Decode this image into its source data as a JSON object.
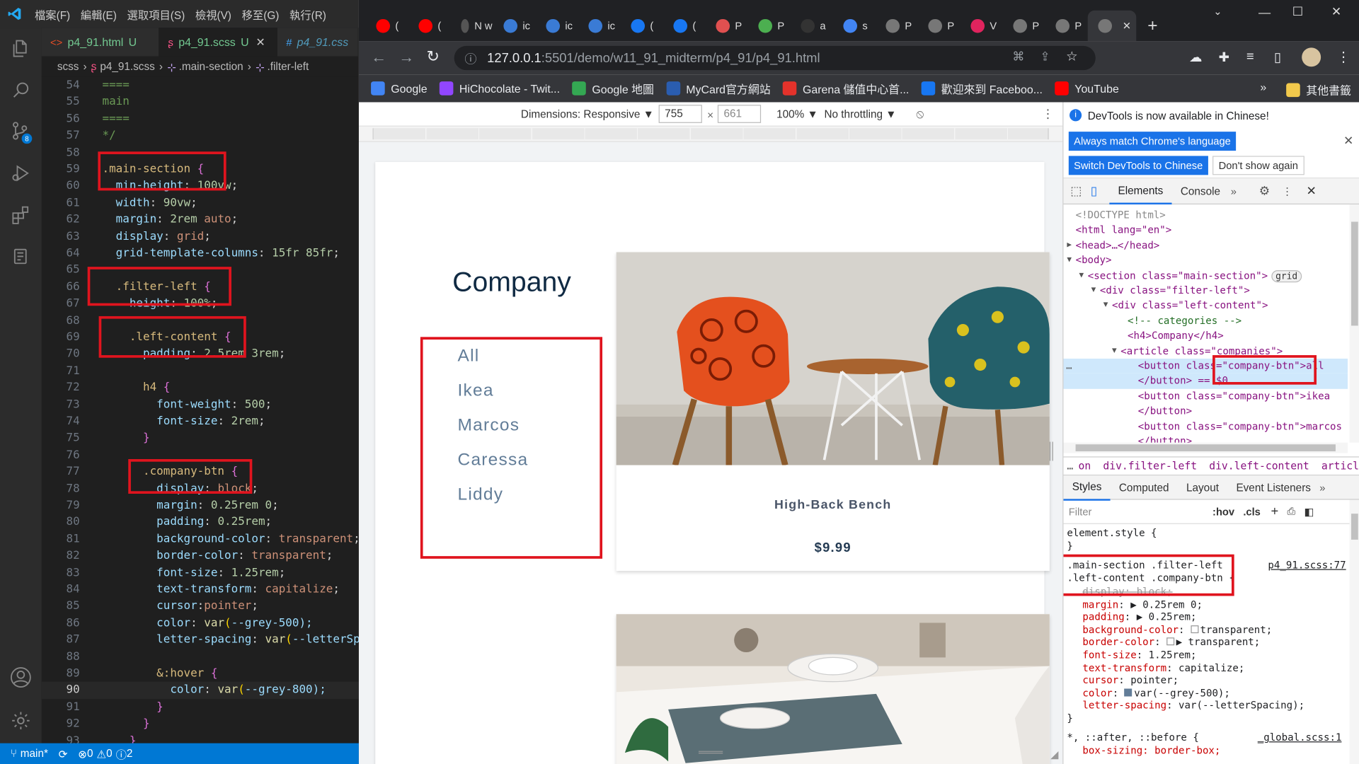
{
  "vscode": {
    "menu": [
      "檔案(F)",
      "編輯(E)",
      "選取項目(S)",
      "檢視(V)",
      "移至(G)",
      "執行(R)"
    ],
    "tabs": [
      {
        "label": "p4_91.html",
        "status": "U",
        "icon": "<>"
      },
      {
        "label": "p4_91.scss",
        "status": "U",
        "icon": "ʂ",
        "close": "✕"
      },
      {
        "label": "p4_91.css",
        "icon": "#"
      }
    ],
    "breadcrumb": [
      "scss",
      "p4_91.scss",
      ".main-section",
      ".filter-left"
    ],
    "status": {
      "branch": "main*",
      "errors": "0",
      "warnings": "0",
      "info": "2"
    },
    "lines": [
      {
        "n": "54",
        "t": "===="
      },
      {
        "n": "55",
        "t": "main"
      },
      {
        "n": "56",
        "t": "===="
      },
      {
        "n": "57",
        "t": "*/"
      },
      {
        "n": "58",
        "t": ""
      },
      {
        "n": "59",
        "t": ".main-section {"
      },
      {
        "n": "60",
        "t": "  min-height: 100vw;"
      },
      {
        "n": "61",
        "t": "  width: 90vw;"
      },
      {
        "n": "62",
        "t": "  margin: 2rem auto;"
      },
      {
        "n": "63",
        "t": "  display: grid;"
      },
      {
        "n": "64",
        "t": "  grid-template-columns: 15fr 85fr;"
      },
      {
        "n": "65",
        "t": ""
      },
      {
        "n": "66",
        "t": "  .filter-left {"
      },
      {
        "n": "67",
        "t": "    height: 100%;"
      },
      {
        "n": "68",
        "t": ""
      },
      {
        "n": "69",
        "t": "    .left-content {"
      },
      {
        "n": "70",
        "t": "      padding: 2.5rem 3rem;"
      },
      {
        "n": "71",
        "t": ""
      },
      {
        "n": "72",
        "t": "      h4 {"
      },
      {
        "n": "73",
        "t": "        font-weight: 500;"
      },
      {
        "n": "74",
        "t": "        font-size: 2rem;"
      },
      {
        "n": "75",
        "t": "      }"
      },
      {
        "n": "76",
        "t": ""
      },
      {
        "n": "77",
        "t": "      .company-btn {"
      },
      {
        "n": "78",
        "t": "        display: block;"
      },
      {
        "n": "79",
        "t": "        margin: 0.25rem 0;"
      },
      {
        "n": "80",
        "t": "        padding: 0.25rem;"
      },
      {
        "n": "81",
        "t": "        background-color: transparent;"
      },
      {
        "n": "82",
        "t": "        border-color: transparent;"
      },
      {
        "n": "83",
        "t": "        font-size: 1.25rem;"
      },
      {
        "n": "84",
        "t": "        text-transform: capitalize;"
      },
      {
        "n": "85",
        "t": "        cursor:pointer;"
      },
      {
        "n": "86",
        "t": "        color: var(--grey-500);"
      },
      {
        "n": "87",
        "t": "        letter-spacing: var(--letterSp"
      },
      {
        "n": "88",
        "t": ""
      },
      {
        "n": "89",
        "t": "        &:hover {"
      },
      {
        "n": "90",
        "t": "          color: var(--grey-800);"
      },
      {
        "n": "91",
        "t": "        }"
      },
      {
        "n": "92",
        "t": "      }"
      },
      {
        "n": "93",
        "t": "    }"
      }
    ]
  },
  "chrome": {
    "tabs": [
      {
        "label": "(",
        "color": "#ff0000"
      },
      {
        "label": "(",
        "color": "#ff0000"
      },
      {
        "label": "N w",
        "color": "#555"
      },
      {
        "label": "ic",
        "color": "#3a7bd5"
      },
      {
        "label": "ic",
        "color": "#3a7bd5"
      },
      {
        "label": "ic",
        "color": "#3a7bd5"
      },
      {
        "label": "(",
        "color": "#1877f2"
      },
      {
        "label": "(",
        "color": "#1877f2"
      },
      {
        "label": "P",
        "color": "#e05050"
      },
      {
        "label": "P",
        "color": "#4caf50"
      },
      {
        "label": "a",
        "color": "#333"
      },
      {
        "label": "s",
        "color": "#4285f4"
      },
      {
        "label": "P",
        "color": "#777"
      },
      {
        "label": "P",
        "color": "#777"
      },
      {
        "label": "V",
        "color": "#e0245e"
      },
      {
        "label": "P",
        "color": "#777"
      },
      {
        "label": "P",
        "color": "#777"
      },
      {
        "label": "",
        "color": "#777"
      }
    ],
    "new_tab": "+",
    "url_host": "127.0.0.1",
    "url_path": ":5501/demo/w11_91_midterm/p4_91/p4_91.html",
    "bookmarks": [
      {
        "label": "Google",
        "color": "#4285f4"
      },
      {
        "label": "HiChocolate - Twit...",
        "color": "#9146ff"
      },
      {
        "label": "Google 地圖",
        "color": "#34a853"
      },
      {
        "label": "MyCard官方網站",
        "color": "#2a5db0"
      },
      {
        "label": "Garena 儲值中心首...",
        "color": "#e4322b"
      },
      {
        "label": "歡迎來到 Faceboo...",
        "color": "#1877f2"
      },
      {
        "label": "YouTube",
        "color": "#ff0000"
      }
    ],
    "bookmarks_more": "»",
    "other_bookmarks": "其他書籤"
  },
  "devmode": {
    "dimensions_label": "Dimensions: Responsive ▼",
    "width": "755",
    "height": "661",
    "zoom": "100% ▼",
    "throttle": "No throttling ▼"
  },
  "page": {
    "title": "Company",
    "companies": [
      "All",
      "Ikea",
      "Marcos",
      "Caressa",
      "Liddy"
    ],
    "products": [
      {
        "name": "High-Back Bench",
        "price": "$9.99"
      }
    ]
  },
  "devtools": {
    "notice": "DevTools is now available in Chinese!",
    "btn_match": "Always match Chrome's language",
    "btn_switch": "Switch DevTools to Chinese",
    "btn_dont": "Don't show again",
    "tabs": [
      "Elements",
      "Console"
    ],
    "crumbs": [
      "on",
      "div.filter-left",
      "div.left-content",
      "article.compan"
    ],
    "style_tabs": [
      "Styles",
      "Computed",
      "Layout",
      "Event Listeners"
    ],
    "filter_placeholder": "Filter",
    "hov": ":hov",
    "cls": ".cls",
    "dom": [
      "<!DOCTYPE html>",
      "<html lang=\"en\">",
      "<head>…</head>",
      "<body>",
      "<section class=\"main-section\">",
      "grid",
      "<div class=\"filter-left\">",
      "<div class=\"left-content\">",
      "<!-- categories -->",
      "<h4>Company</h4>",
      "<article class=\"companies\">",
      "<button class=\"company-btn\">all",
      "</button> == $0",
      "<button class=\"company-btn\">ikea",
      "</button>",
      "<button class=\"company-btn\">marcos",
      "</button>"
    ],
    "rules": {
      "element_style": "element.style {",
      "selector1": ".main-section .filter-left",
      "selector2": ".left-content .company-btn {",
      "source": "p4_91.scss:77",
      "props": [
        {
          "p": "display",
          "v": "block;"
        },
        {
          "p": "margin",
          "v": "▶ 0.25rem 0;"
        },
        {
          "p": "padding",
          "v": "▶ 0.25rem;"
        },
        {
          "p": "background-color",
          "v": "transparent;"
        },
        {
          "p": "border-color",
          "v": "▶ transparent;"
        },
        {
          "p": "font-size",
          "v": "1.25rem;"
        },
        {
          "p": "text-transform",
          "v": "capitalize;"
        },
        {
          "p": "cursor",
          "v": "pointer;"
        },
        {
          "p": "color",
          "v": "var(--grey-500);"
        },
        {
          "p": "letter-spacing",
          "v": "var(--letterSpacing);"
        }
      ],
      "global_selector": "*, ::after, ::before {",
      "global_source": "_global.scss:1",
      "global_prop": "box-sizing: border-box;"
    }
  }
}
